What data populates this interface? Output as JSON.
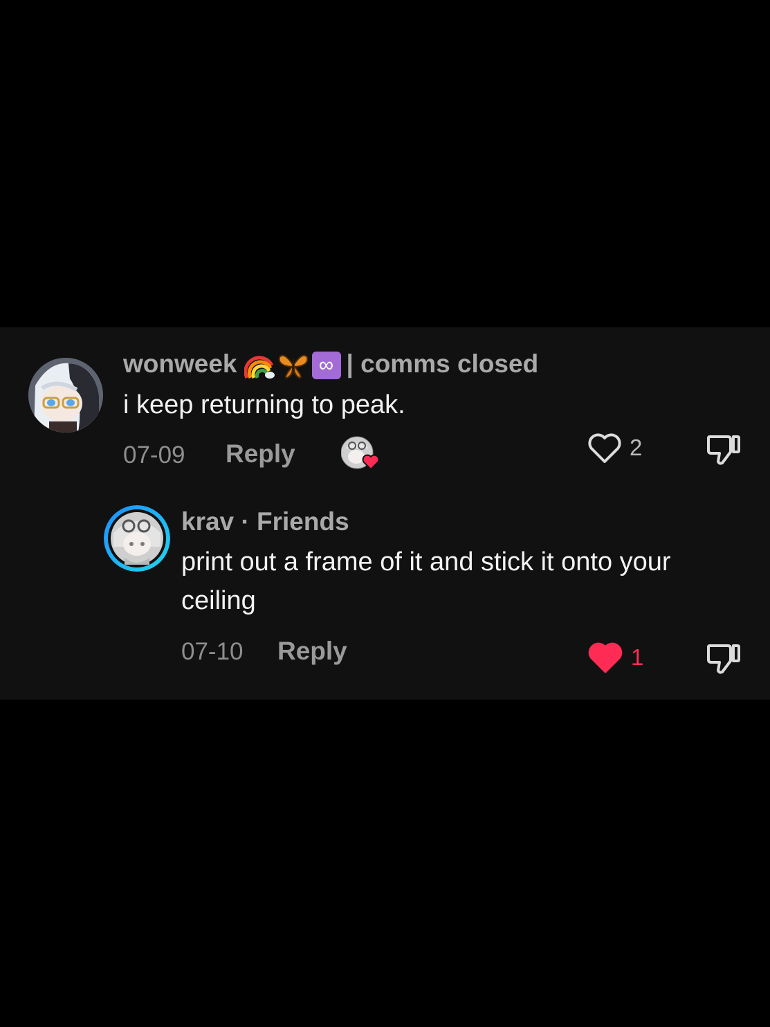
{
  "comments": [
    {
      "username": "wonweek",
      "badges": [
        "rainbow-icon",
        "butterfly-icon",
        "infinity-icon"
      ],
      "badge_infinity_glyph": "∞",
      "username_suffix": "| comms closed",
      "text": "i keep returning to peak.",
      "date": "07-09",
      "reply_label": "Reply",
      "like_count": "2",
      "liked": false,
      "creator_liked": true
    },
    {
      "username": "krav",
      "separator": "·",
      "relation": "Friends",
      "text": "print out a frame of it and stick it onto your ceiling",
      "date": "07-10",
      "reply_label": "Reply",
      "like_count": "1",
      "liked": true
    }
  ],
  "colors": {
    "background": "#000000",
    "panel": "#111111",
    "username": "#a9a9a9",
    "text": "#f2f2f2",
    "meta": "#8e8e8e",
    "like_active": "#fe2c55",
    "friend_ring_start": "#20d5ec",
    "friend_ring_end": "#1e90ff"
  }
}
